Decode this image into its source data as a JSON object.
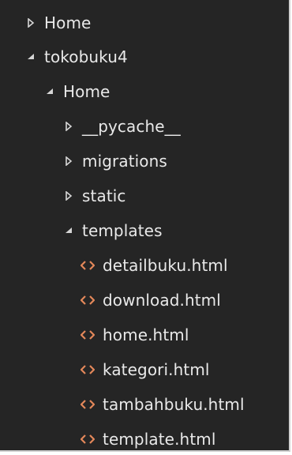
{
  "colors": {
    "panel_bg": "#252525",
    "text": "#e9e9e9",
    "arrow": "#d6d6d6",
    "html_icon": "#e4885a"
  },
  "tree": [
    {
      "label": "Home",
      "state": "collapsed",
      "icon": "caret-right-icon"
    },
    {
      "label": "tokobuku4",
      "state": "expanded",
      "icon": "caret-down-icon"
    },
    {
      "label": "Home",
      "state": "expanded",
      "icon": "caret-down-icon"
    },
    {
      "label": "__pycache__",
      "state": "collapsed",
      "icon": "caret-right-icon"
    },
    {
      "label": "migrations",
      "state": "collapsed",
      "icon": "caret-right-icon"
    },
    {
      "label": "static",
      "state": "collapsed",
      "icon": "caret-right-icon"
    },
    {
      "label": "templates",
      "state": "expanded",
      "icon": "caret-down-icon"
    },
    {
      "label": "detailbuku.html",
      "type": "file",
      "icon": "html-file-icon"
    },
    {
      "label": "download.html",
      "type": "file",
      "icon": "html-file-icon"
    },
    {
      "label": "home.html",
      "type": "file",
      "icon": "html-file-icon"
    },
    {
      "label": "kategori.html",
      "type": "file",
      "icon": "html-file-icon"
    },
    {
      "label": "tambahbuku.html",
      "type": "file",
      "icon": "html-file-icon"
    },
    {
      "label": "template.html",
      "type": "file",
      "icon": "html-file-icon"
    }
  ]
}
